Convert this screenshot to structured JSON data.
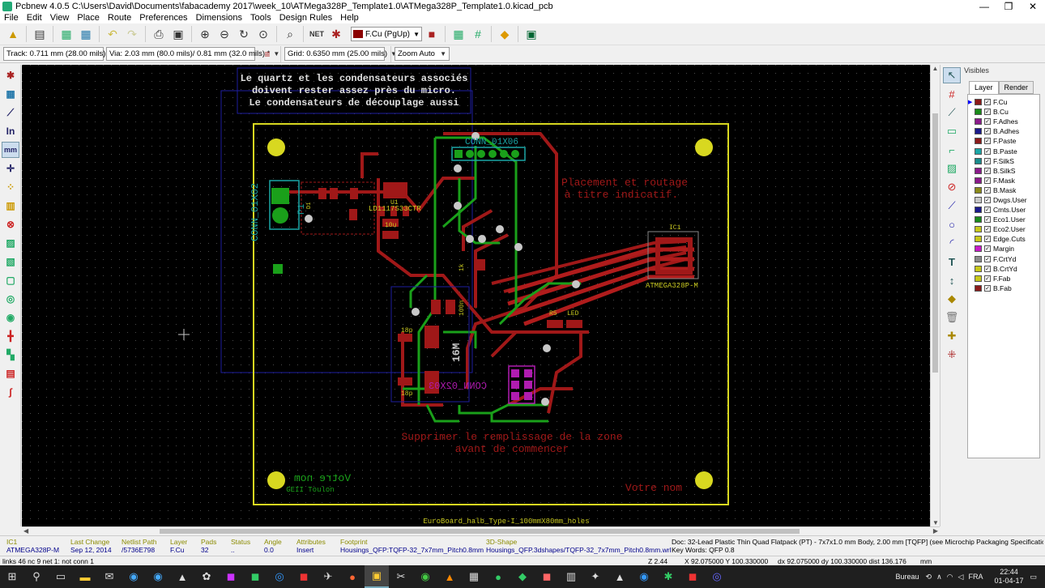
{
  "window": {
    "title": "Pcbnew 4.0.5 C:\\Users\\David\\Documents\\fabacademy 2017\\week_10\\ATMega328P_Template1.0\\ATMega328P_Template1.0.kicad_pcb",
    "minimize": "—",
    "maximize": "❐",
    "close": "✕"
  },
  "menu": [
    "File",
    "Edit",
    "View",
    "Place",
    "Route",
    "Preferences",
    "Dimensions",
    "Tools",
    "Design Rules",
    "Help"
  ],
  "toolbar": {
    "active_layer": "F.Cu (PgUp)"
  },
  "toolbar2": {
    "track": "Track: 0.711 mm (28.00 mils) *",
    "via": "Via: 2.03 mm (80.0 mils)/ 0.81 mm (32.0 mils) *",
    "grid": "Grid: 0.6350 mm (25.00 mils)",
    "zoom": "Zoom Auto"
  },
  "board": {
    "note_quartz_1": "Le quartz et les condensateurs associés",
    "note_quartz_2": "doivent rester assez près du micro.",
    "note_quartz_3": "Le condensateurs de découplage aussi",
    "note_placement_1": "Placement et routage",
    "note_placement_2": "à titre indicatif.",
    "note_fill_1": "Supprimer le remplissage de la zone",
    "note_fill_2": "avant de commencer",
    "votre_nom_right": "Votre nom",
    "votre_nom_mirror": "Votre nom",
    "geii": "GEII Toulon",
    "footer": "EuroBoard_halb_Type-I_100mmX80mm_holes",
    "conn_01x06": "CONN_01X06",
    "conn_01x02": "CONN_01X02",
    "p1": "P1",
    "ic1": "IC1",
    "atmega": "ATMEGA328P-M",
    "ld1117": "LD1117S33CTR",
    "u1": "U1",
    "c10u": "10u",
    "c100n": "100n",
    "c18p_top": "18p",
    "c18p_bot": "18p",
    "xtal": "16M",
    "r_1k": "1k",
    "r5": "R5",
    "led": "LED",
    "conn_2x03": "CONN_02X03",
    "d1": "D1"
  },
  "visibles": {
    "title": "Visibles",
    "tab_layer": "Layer",
    "tab_render": "Render",
    "layers": [
      {
        "name": "F.Cu",
        "color": "#8b1a1a"
      },
      {
        "name": "B.Cu",
        "color": "#1a8b1a"
      },
      {
        "name": "F.Adhes",
        "color": "#8b1a8b"
      },
      {
        "name": "B.Adhes",
        "color": "#1a1a8b"
      },
      {
        "name": "F.Paste",
        "color": "#8b1a1a"
      },
      {
        "name": "B.Paste",
        "color": "#1aa5a5"
      },
      {
        "name": "F.SilkS",
        "color": "#1a8b8b"
      },
      {
        "name": "B.SilkS",
        "color": "#8b1a8b"
      },
      {
        "name": "F.Mask",
        "color": "#8b1a8b"
      },
      {
        "name": "B.Mask",
        "color": "#8b8b1a"
      },
      {
        "name": "Dwgs.User",
        "color": "#c8c8c8"
      },
      {
        "name": "Cmts.User",
        "color": "#1a1a8b"
      },
      {
        "name": "Eco1.User",
        "color": "#1a8b1a"
      },
      {
        "name": "Eco2.User",
        "color": "#c8c81a"
      },
      {
        "name": "Edge.Cuts",
        "color": "#c8c81a"
      },
      {
        "name": "Margin",
        "color": "#c81ac8"
      },
      {
        "name": "F.CrtYd",
        "color": "#8b8b8b"
      },
      {
        "name": "B.CrtYd",
        "color": "#c8c81a"
      },
      {
        "name": "F.Fab",
        "color": "#c8c81a"
      },
      {
        "name": "B.Fab",
        "color": "#8b1a1a"
      }
    ]
  },
  "msgpanel": [
    {
      "h": "IC1",
      "v": "ATMEGA328P-M"
    },
    {
      "h": "Last Change",
      "v": "Sep 12, 2014"
    },
    {
      "h": "Netlist Path",
      "v": "/5736E798"
    },
    {
      "h": "Layer",
      "v": "F.Cu"
    },
    {
      "h": "Pads",
      "v": "32"
    },
    {
      "h": "Status",
      "v": ".."
    },
    {
      "h": "Angle",
      "v": "0.0"
    },
    {
      "h": "Attributes",
      "v": "Insert"
    },
    {
      "h": "Footprint",
      "v": "Housings_QFP:TQFP-32_7x7mm_Pitch0.8mm"
    },
    {
      "h": "3D-Shape",
      "v": "Housings_QFP.3dshapes/TQFP-32_7x7mm_Pitch0.8mm.wrl"
    },
    {
      "h": "Doc: 32-Lead Plastic Thin Quad Flatpack (PT) - 7x7x1.0 mm Body, 2.00 mm [TQFP] (see Microchip Packaging Specification 00000049",
      "v": "Key Words: QFP 0.8"
    }
  ],
  "status": {
    "links": "links 46 nc 9  net 1: not conn 1",
    "z": "Z 2.44",
    "xy": "X 92.075000  Y 100.330000",
    "dxy": "dx 92.075000  dy 100.330000  dist 136.176",
    "units": "mm"
  },
  "taskbar": {
    "bureau": "Bureau",
    "lang": "FRA",
    "time": "22:44",
    "date": "01-04-17"
  }
}
